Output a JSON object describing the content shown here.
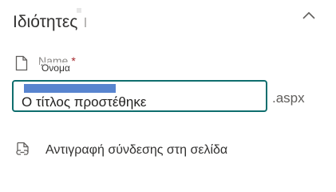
{
  "panel": {
    "title": "Ιδιότητες",
    "collapse_icon": "chevron-up-icon"
  },
  "name_field": {
    "icon": "file-icon",
    "label": "Name",
    "required_marker": "*",
    "tooltip": "Όνομα",
    "value": "Ο τίτλος προστέθηκε",
    "suffix": ".aspx"
  },
  "copy_link": {
    "icon": "copy-link-icon",
    "label": "Αντιγραφή σύνδεσης στη σελίδα"
  },
  "colors": {
    "input_border": "#0f6e6e",
    "selection": "#3b6fc7",
    "required": "#a4262c"
  }
}
